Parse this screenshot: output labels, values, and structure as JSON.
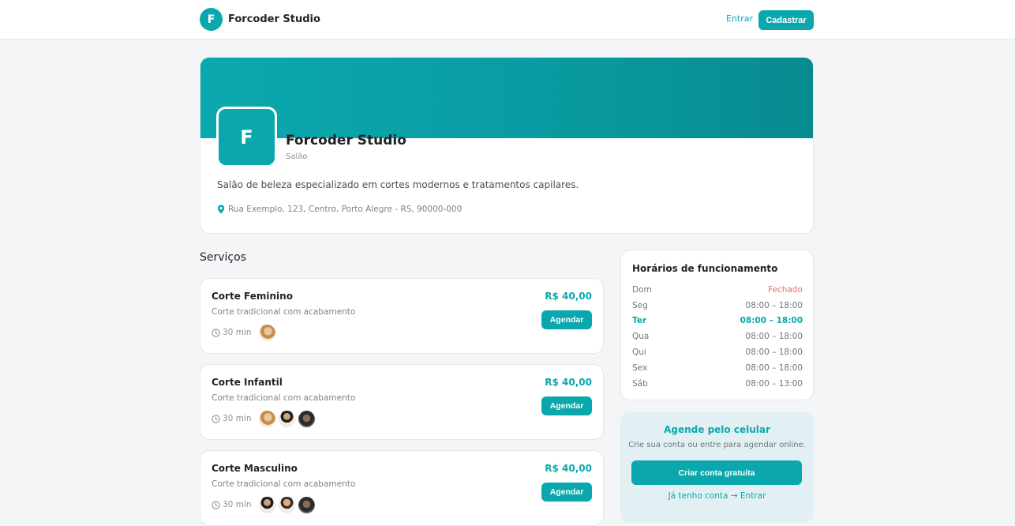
{
  "header": {
    "logo_letter": "F",
    "brand_name": "Forcoder Studio",
    "login_label": "Entrar",
    "signup_label": "Cadastrar"
  },
  "profile": {
    "avatar_letter": "F",
    "name": "Forcoder Studio",
    "category": "Salão",
    "description": "Salão de beleza especializado em cortes modernos e tratamentos capilares.",
    "address": "Rua Exemplo, 123, Centro, Porto Alegre - RS, 90000-000",
    "accent_color": "#0aa8ad"
  },
  "services": {
    "title": "Serviços",
    "items": [
      {
        "name": "Corte Feminino",
        "description": "Corte tradicional com acabamento",
        "duration": "30 min",
        "price": "R$ 40,00",
        "book_label": "Agendar",
        "professional_avatars": [
          "avatar-woman-blonde"
        ]
      },
      {
        "name": "Corte Infantil",
        "description": "Corte tradicional com acabamento",
        "duration": "30 min",
        "price": "R$ 40,00",
        "book_label": "Agendar",
        "professional_avatars": [
          "avatar-woman-blonde",
          "avatar-man-beard",
          "avatar-man-dark"
        ]
      },
      {
        "name": "Corte Masculino",
        "description": "Corte tradicional com acabamento",
        "duration": "30 min",
        "price": "R$ 40,00",
        "book_label": "Agendar",
        "professional_avatars": [
          "avatar-man-beard",
          "avatar-man-light",
          "avatar-man-dark"
        ]
      }
    ]
  },
  "hours": {
    "title": "Horários de funcionamento",
    "rows": [
      {
        "day": "Dom",
        "time": "Fechado"
      },
      {
        "day": "Seg",
        "time": "08:00 – 18:00"
      },
      {
        "day": "Ter",
        "time": "08:00 – 18:00"
      },
      {
        "day": "Qua",
        "time": "08:00 – 18:00"
      },
      {
        "day": "Qui",
        "time": "08:00 – 18:00"
      },
      {
        "day": "Sex",
        "time": "08:00 – 18:00"
      },
      {
        "day": "Sáb",
        "time": "08:00 – 13:00"
      }
    ],
    "closed_color": "#e26f6f"
  },
  "promo": {
    "title": "Agende pelo celular",
    "subtitle": "Crie sua conta ou entre para agendar online.",
    "cta_label": "Criar conta gratuita",
    "login_label": "Já tenho conta → Entrar"
  }
}
